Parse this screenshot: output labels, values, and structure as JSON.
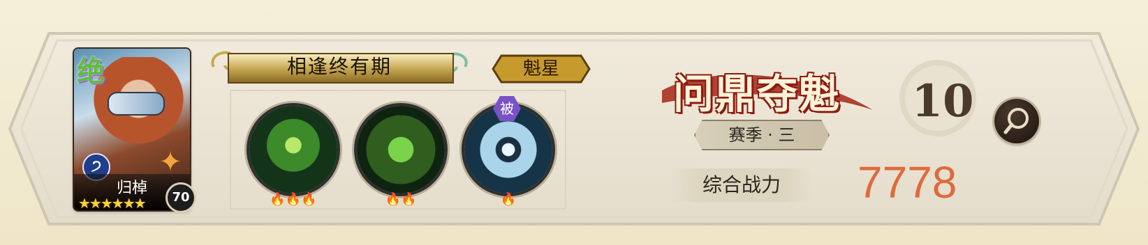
{
  "character": {
    "grade": "绝",
    "element_icon": "water-swirl-icon",
    "name": "归棹",
    "stars": "★★★★★★",
    "level": "70"
  },
  "title_plaque": {
    "text": "相逢终有期"
  },
  "rank_badge": {
    "text": "魁星"
  },
  "skills": [
    {
      "name": "skill-1",
      "flames": "🔥🔥🔥"
    },
    {
      "name": "skill-2",
      "flames": "🔥🔥"
    },
    {
      "name": "skill-3",
      "flames": "🔥",
      "tag": "被"
    }
  ],
  "season": {
    "title": "问鼎夺魁",
    "subtitle": "赛季 · 三",
    "rank": "10"
  },
  "power": {
    "label": "综合战力",
    "value": "7778"
  },
  "colors": {
    "power_value": "#e06a3a",
    "season_title_stroke": "#8d1b10",
    "background": "#f5efd9"
  }
}
